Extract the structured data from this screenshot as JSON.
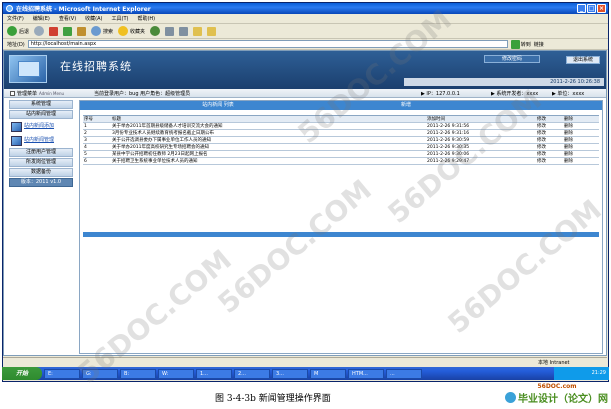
{
  "browser": {
    "title": "在线招聘系统 - Microsoft Internet Explorer",
    "menu": [
      "文件(F)",
      "编辑(E)",
      "查看(V)",
      "收藏(A)",
      "工具(T)",
      "帮助(H)"
    ],
    "toolbar": {
      "back": "后退",
      "search": "搜索",
      "favorites": "收藏夹"
    },
    "address_label": "地址(D)",
    "address": "http://localhost/main.aspx",
    "go": "转到",
    "links": "链接"
  },
  "header": {
    "system_title": "在线招聘系统",
    "change_password": "修改密码",
    "exit": "退出系统",
    "date": "2011-2-26 10:26:38"
  },
  "infobar": {
    "side_title": "管理菜单",
    "side_sub": "Admin Menu",
    "user_info": "当前登录用户：bug  用户角色：超级管理员",
    "ip": "▶ IP：127.0.0.1",
    "system_dev": "▶ 系统开发者：xxxx",
    "unit": "▶ 单位：xxxx"
  },
  "sidebar": {
    "items_top": [
      "系统管理",
      "站内新闻管理"
    ],
    "link1": "站内新闻添加",
    "link2": "站内新闻管理",
    "items_bottom": [
      "注册用户管理",
      "所发岗位管理",
      "数据备份"
    ],
    "footer": "版本：2011 v1.0"
  },
  "main": {
    "tab_list": "站内新闻 列表",
    "tab_add": "新增",
    "columns": [
      "序号",
      "标题",
      "添加时间",
      "修改",
      "删除"
    ],
    "rows": [
      [
        "1",
        "关于举办2011年首期县级储备人才培训交流大会的通知",
        "2011-2-26 9:31:56",
        "修改",
        "删除"
      ],
      [
        "2",
        "3月份专业技术人员继续教育统考报名截止日期公布",
        "2011-2-26 9:31:16",
        "修改",
        "删除"
      ],
      [
        "3",
        "关于公开选调县委办下属事业单位工作人员的通知",
        "2011-2-26 9:30:59",
        "修改",
        "删除"
      ],
      [
        "4",
        "关于举办2011年度高校研究生专场招聘会的通知",
        "2011-2-26 9:30:35",
        "修改",
        "删除"
      ],
      [
        "5",
        "某县中学公开招聘初任教师 2月23日起网上报名",
        "2011-2-26 9:30:06",
        "修改",
        "删除"
      ],
      [
        "6",
        "关于招聘卫生系统事业单位技术人员的通知",
        "2011-2-26 9:29:47",
        "修改",
        "删除"
      ]
    ]
  },
  "statusbar": {
    "zone": "本地 Intranet"
  },
  "taskbar": {
    "start": "开始",
    "tasks": [
      "E:",
      "G:",
      "B:",
      "W:",
      "1...",
      "2...",
      "3...",
      "M",
      "HTM...",
      "...",
      "..."
    ],
    "time": "21:29"
  },
  "caption": "图 3-4-3b    新闻管理操作界面",
  "brand": {
    "url": "56DOC.com",
    "name": "毕业设计（论文）网"
  },
  "watermark": "56DOC.COM"
}
